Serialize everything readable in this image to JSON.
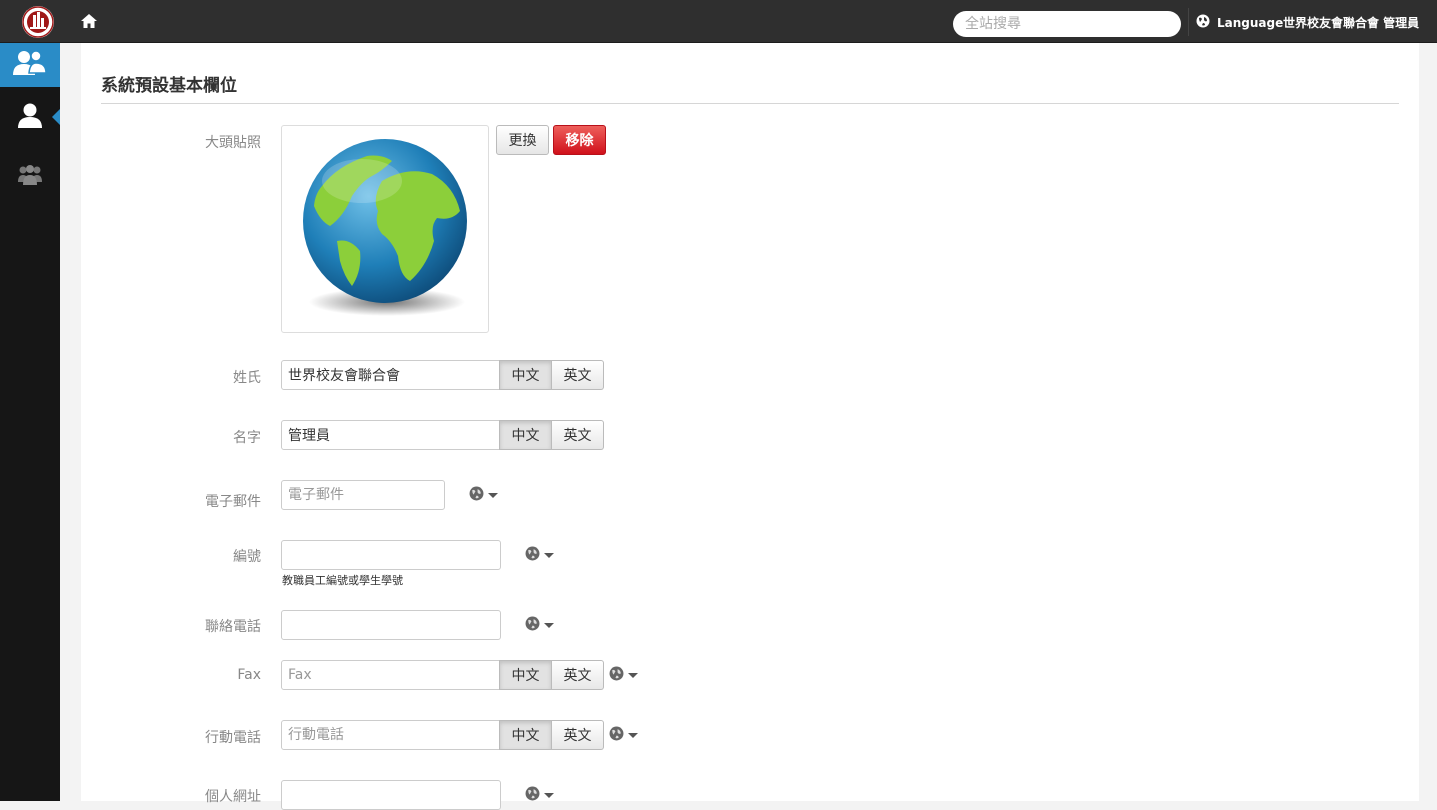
{
  "topbar": {
    "search_placeholder": "全站搜尋",
    "language_label": "Language",
    "user_label": "世界校友會聯合會 管理員"
  },
  "page": {
    "title": "系統預設基本欄位"
  },
  "form": {
    "avatar": {
      "label": "大頭貼照",
      "change_button": "更換",
      "remove_button": "移除"
    },
    "last_name": {
      "label": "姓氏",
      "value": "世界校友會聯合會",
      "lang_zh": "中文",
      "lang_en": "英文"
    },
    "first_name": {
      "label": "名字",
      "value": "管理員",
      "lang_zh": "中文",
      "lang_en": "英文"
    },
    "email": {
      "label": "電子郵件",
      "placeholder": "電子郵件"
    },
    "id_number": {
      "label": "編號",
      "value": "",
      "help": "教職員工編號或學生學號"
    },
    "phone": {
      "label": "聯絡電話",
      "value": ""
    },
    "fax": {
      "label": "Fax",
      "placeholder": "Fax",
      "lang_zh": "中文",
      "lang_en": "英文"
    },
    "mobile": {
      "label": "行動電話",
      "placeholder": "行動電話",
      "lang_zh": "中文",
      "lang_en": "英文"
    },
    "website": {
      "label": "個人網址",
      "value": ""
    }
  },
  "colors": {
    "accent": "#2a8cc7",
    "danger": "#d0111b",
    "topbar": "#2f2f2f",
    "sidebar": "#161616"
  },
  "icons": {
    "logo": "school-logo-icon",
    "home": "home-icon",
    "language": "globe-icon",
    "sidebar": [
      "members-icon",
      "user-icon",
      "group-icon"
    ],
    "privacy": "globe-icon"
  }
}
